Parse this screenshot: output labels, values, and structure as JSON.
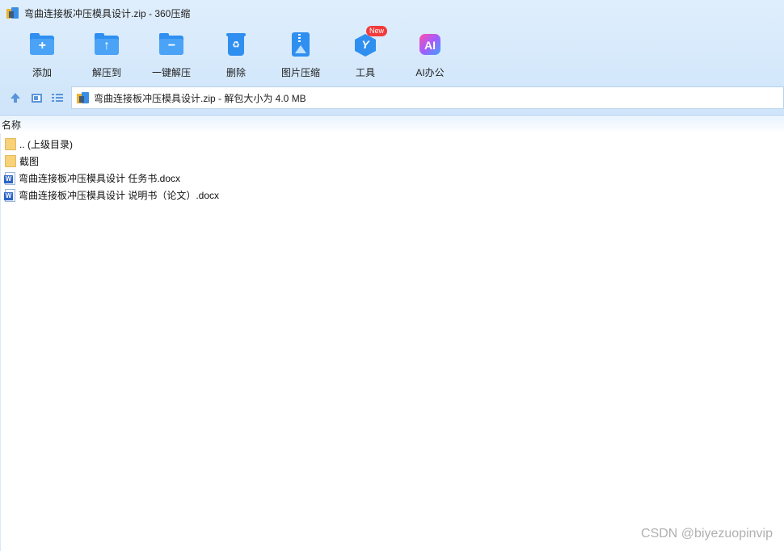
{
  "window": {
    "title": "弯曲连接板冲压模具设计.zip - 360压缩"
  },
  "toolbar": {
    "items": [
      {
        "label": "添加",
        "icon": "add-folder-icon"
      },
      {
        "label": "解压到",
        "icon": "extract-to-icon"
      },
      {
        "label": "一键解压",
        "icon": "one-click-extract-icon"
      },
      {
        "label": "删除",
        "icon": "recycle-bin-icon"
      },
      {
        "label": "图片压缩",
        "icon": "image-compress-icon"
      },
      {
        "label": "工具",
        "icon": "tools-icon",
        "badge": "New"
      },
      {
        "label": "AI办公",
        "icon": "ai-office-icon",
        "glyph": "AI"
      }
    ]
  },
  "nav": {
    "address": "弯曲连接板冲压模具设计.zip - 解包大小为 4.0 MB"
  },
  "list": {
    "header": "名称",
    "rows": [
      {
        "name": ".. (上级目录)",
        "type": "folder"
      },
      {
        "name": "截图",
        "type": "folder"
      },
      {
        "name": "弯曲连接板冲压模具设计 任务书.docx",
        "type": "docx"
      },
      {
        "name": "弯曲连接板冲压模具设计 说明书（论文）.docx",
        "type": "docx"
      }
    ]
  },
  "watermark": "CSDN @biyezuopinvip",
  "colors": {
    "toolbar_bg": "#d6e9fb",
    "icon_blue": "#2f8ff0",
    "badge_red": "#f23b3b"
  }
}
